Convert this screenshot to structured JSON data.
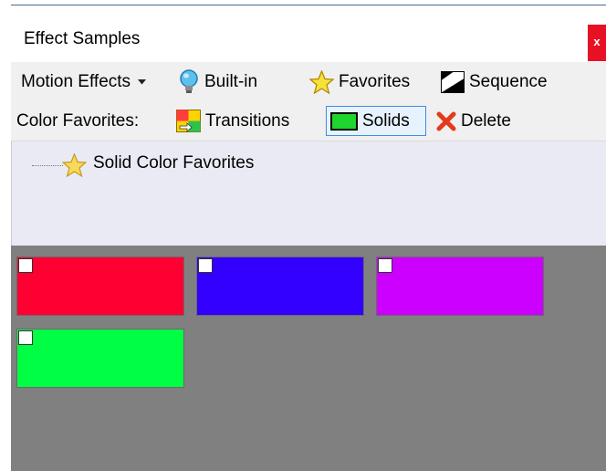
{
  "window": {
    "title": "Effect Samples",
    "close_label": "x"
  },
  "toolbar1": {
    "motion_effects": "Motion Effects",
    "built_in": "Built-in",
    "favorites": "Favorites",
    "sequence": "Sequence"
  },
  "toolbar2": {
    "color_favorites": "Color Favorites:",
    "transitions": "Transitions",
    "solids": "Solids",
    "delete": "Delete"
  },
  "tree": {
    "item_label": "Solid Color Favorites"
  },
  "colors": {
    "swatches": [
      "#ff0033",
      "#3300ff",
      "#cc00ff",
      "#00ff44"
    ],
    "close_button": "#e81123",
    "selected_border": "#3d8ee0",
    "panel_background": "#808080"
  },
  "icons": [
    "chevron-down-icon",
    "lightbulb-icon",
    "star-icon",
    "sequence-icon",
    "transitions-icon",
    "solid-color-icon",
    "delete-icon",
    "tree-star-icon"
  ]
}
